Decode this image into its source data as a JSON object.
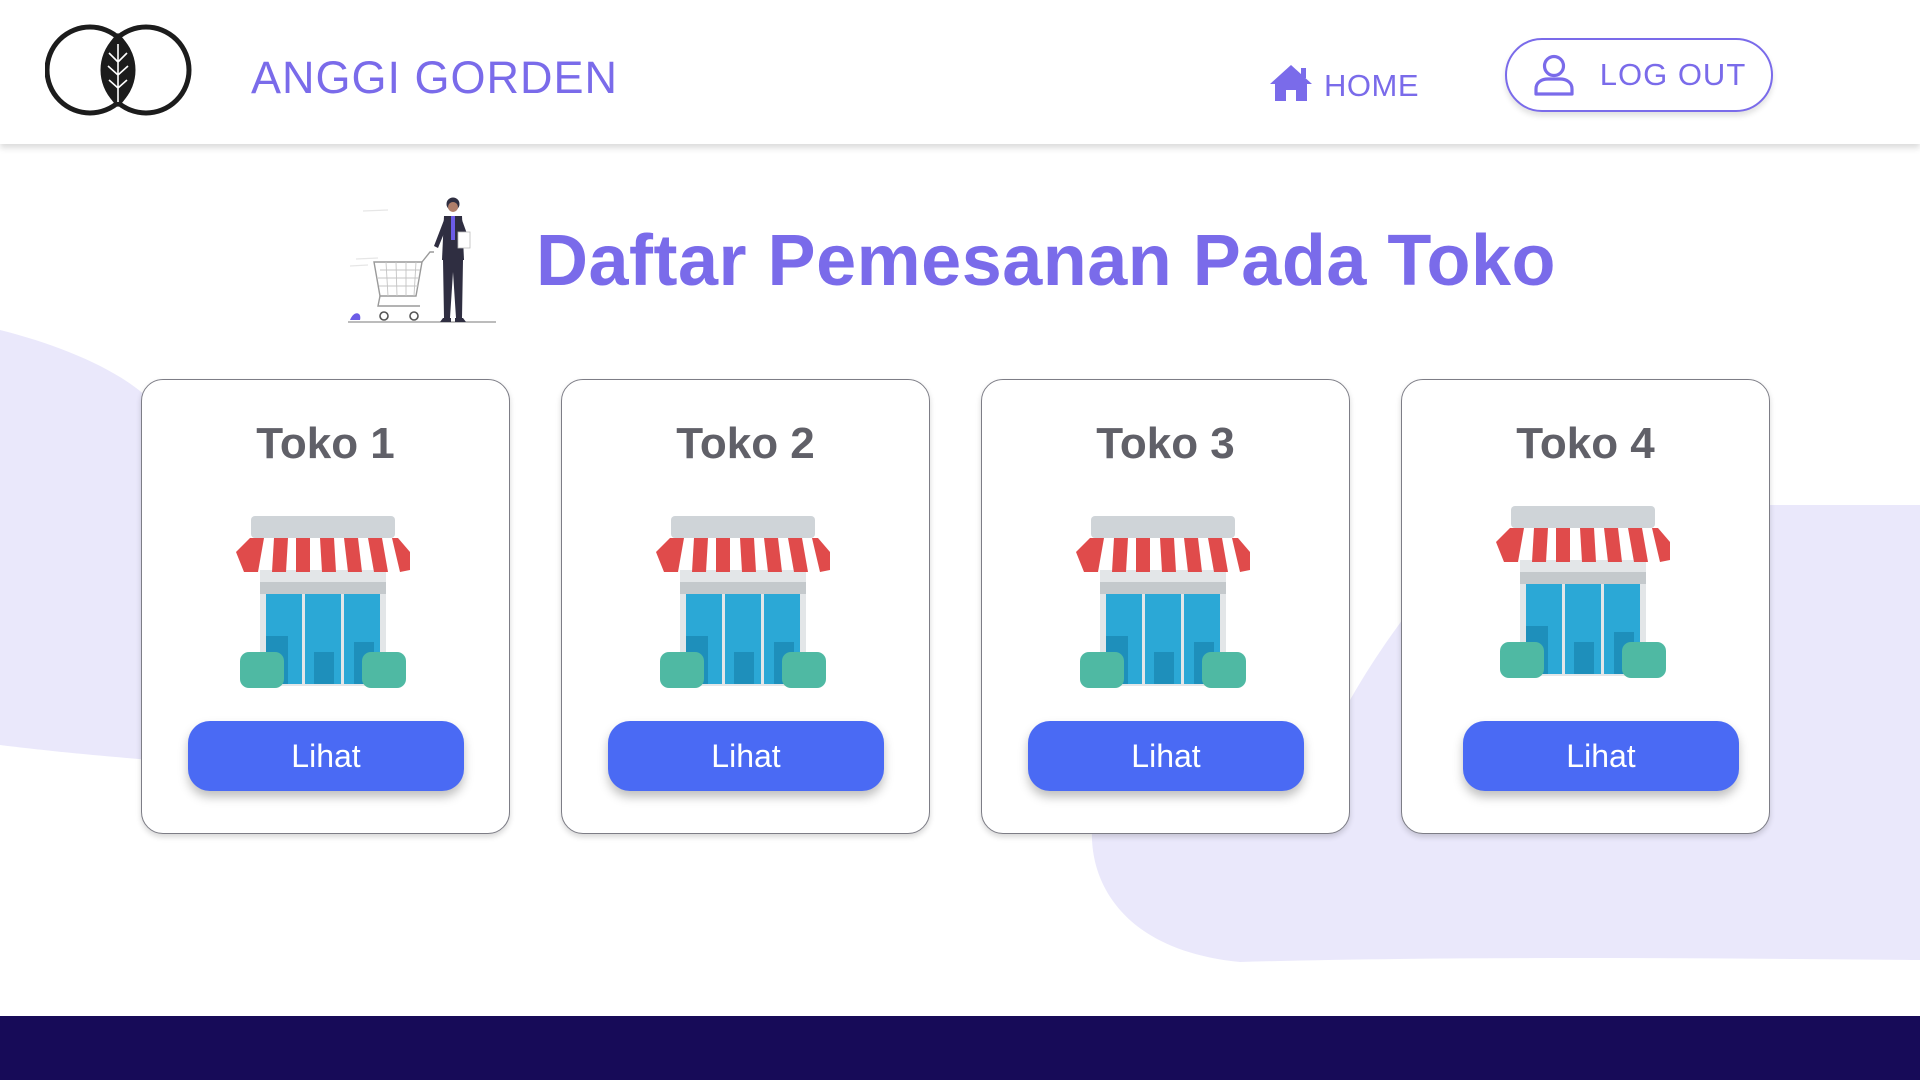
{
  "header": {
    "brand": "ANGGI GORDEN",
    "nav_home_label": "HOME",
    "logout_label": "LOG OUT"
  },
  "main": {
    "title": "Daftar Pemesanan Pada Toko",
    "stores": [
      {
        "name": "Toko 1",
        "button_label": "Lihat"
      },
      {
        "name": "Toko 2",
        "button_label": "Lihat"
      },
      {
        "name": "Toko 3",
        "button_label": "Lihat"
      },
      {
        "name": "Toko 4",
        "button_label": "Lihat"
      }
    ]
  },
  "icons": {
    "logo": "leaf-circle-logo",
    "home": "home-icon",
    "logout": "user-icon",
    "store": "storefront-icon"
  },
  "colors": {
    "accent": "#7a6bea",
    "button": "#4a6af4",
    "footer": "#170b58",
    "background_blob": "#eae8fb",
    "card_title": "#606068"
  }
}
